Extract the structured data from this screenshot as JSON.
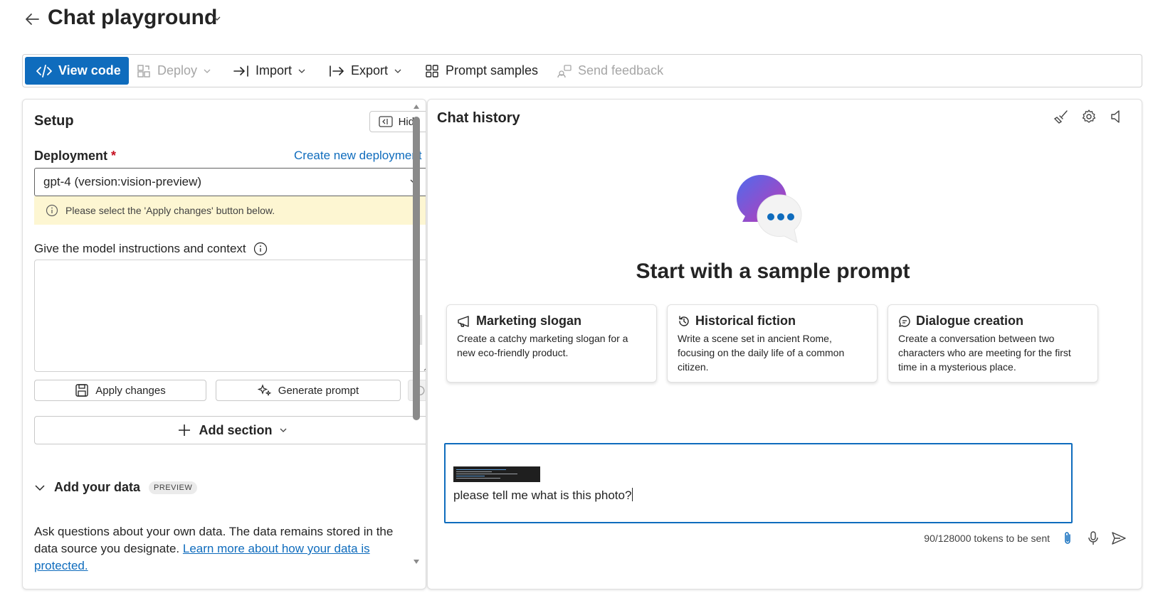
{
  "header": {
    "title": "Chat playground"
  },
  "toolbar": {
    "view_code": "View code",
    "deploy": "Deploy",
    "import": "Import",
    "export": "Export",
    "prompt_samples": "Prompt samples",
    "send_feedback": "Send feedback"
  },
  "setup": {
    "title": "Setup",
    "hide": "Hide",
    "deployment_label": "Deployment",
    "required_mark": "*",
    "create_link": "Create new deployment",
    "selected_deployment": "gpt-4 (version:vision-preview)",
    "warning": "Please select the 'Apply changes' button below.",
    "instructions_label": "Give the model instructions and context",
    "instructions_value": "",
    "apply_changes": "Apply changes",
    "generate_prompt": "Generate prompt",
    "add_section": "Add section",
    "add_data_title": "Add your data",
    "preview_badge": "PREVIEW",
    "data_desc": "Ask questions about your own data. The data remains stored in the data source you designate.",
    "data_link": "Learn more about how your data is protected."
  },
  "chat": {
    "title": "Chat history",
    "start_heading": "Start with a sample prompt",
    "samples": [
      {
        "title": "Marketing slogan",
        "body": "Create a catchy marketing slogan for a new eco-friendly product.",
        "icon": "megaphone-icon"
      },
      {
        "title": "Historical fiction",
        "body": "Write a scene set in ancient Rome, focusing on the daily life of a common citizen.",
        "icon": "history-icon"
      },
      {
        "title": "Dialogue creation",
        "body": "Create a conversation between two characters who are meeting for the first time in a mysterious place.",
        "icon": "chat-bubble-icon"
      }
    ],
    "input_text": "please tell me what is this photo?",
    "token_count": "90/128000 tokens to be sent"
  },
  "colors": {
    "accent": "#0f6cbd",
    "warning_bg": "#fdf6d2",
    "required": "#c50f1f"
  }
}
